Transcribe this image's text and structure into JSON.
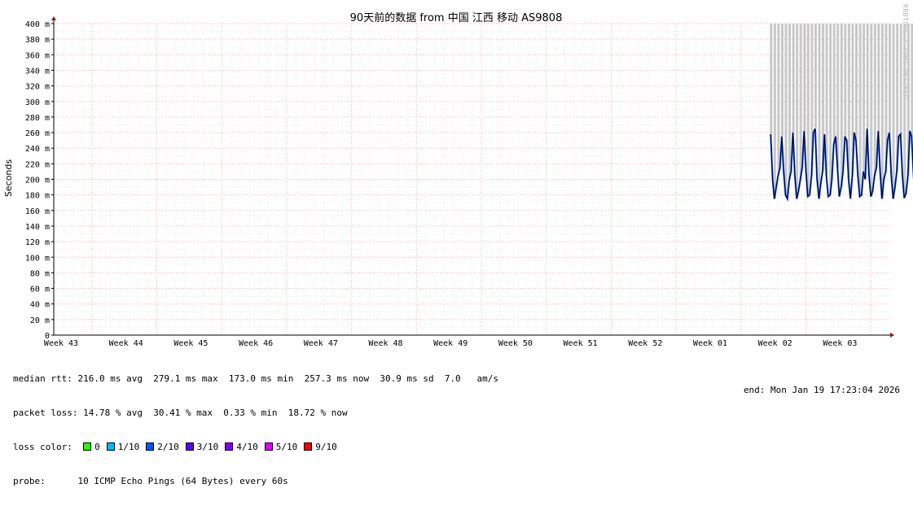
{
  "title": "90天前的数据 from 中国 江西 移动 AS9808",
  "watermark": "RRDTOOL / TOBI OETIKER",
  "chart_data": {
    "type": "line",
    "ylabel": "Seconds",
    "ylim": [
      0,
      400
    ],
    "y_unit": "m",
    "y_ticks": [
      "0",
      "20 m",
      "40 m",
      "60 m",
      "80 m",
      "100 m",
      "120 m",
      "140 m",
      "160 m",
      "180 m",
      "200 m",
      "220 m",
      "240 m",
      "260 m",
      "280 m",
      "300 m",
      "320 m",
      "340 m",
      "360 m",
      "380 m",
      "400 m"
    ],
    "x_ticks": [
      "Week 43",
      "Week 44",
      "Week 45",
      "Week 46",
      "Week 47",
      "Week 48",
      "Week 49",
      "Week 50",
      "Week 51",
      "Week 52",
      "Week 01",
      "Week 02",
      "Week 03"
    ],
    "grid": true,
    "series": [
      {
        "color": "#000000",
        "x_days_from_week02_start": [
          -0.3,
          -0.1,
          0.1,
          0.3,
          0.5,
          0.7,
          0.9,
          1.1,
          1.3,
          1.5,
          1.7,
          1.9,
          2.1,
          2.3,
          2.5,
          2.7,
          2.9,
          3.1,
          3.3,
          3.5,
          3.7,
          3.9,
          4.1,
          4.3,
          4.5,
          4.7,
          4.9,
          5.1,
          5.3,
          5.5,
          5.7,
          5.9,
          6.1,
          6.3,
          6.5,
          6.7,
          6.9,
          7.1,
          7.3,
          7.5,
          7.7,
          7.9,
          8.1,
          8.3,
          8.5,
          8.7,
          8.9,
          9.1,
          9.3,
          9.5,
          9.7,
          9.9,
          10.1,
          10.3,
          10.5,
          10.7,
          10.9,
          11.1,
          11.3,
          11.5,
          11.7,
          11.9,
          12.1,
          12.3,
          12.5,
          12.7,
          12.9,
          13.1,
          13.3,
          13.5,
          13.7,
          13.9,
          14.1,
          14.3,
          14.5,
          14.7,
          14.9,
          15.1,
          15.3,
          15.5,
          15.7,
          15.9,
          16.1,
          16.3,
          16.5,
          16.7,
          16.9,
          17.1,
          17.3,
          17.5,
          17.7,
          17.9,
          18.1,
          18.3,
          18.5,
          18.7,
          18.9,
          19.1,
          19.3
        ],
        "y_ms": [
          258,
          200,
          175,
          190,
          205,
          215,
          255,
          210,
          180,
          175,
          200,
          210,
          260,
          205,
          175,
          185,
          200,
          215,
          262,
          210,
          178,
          180,
          205,
          260,
          265,
          200,
          175,
          195,
          210,
          258,
          205,
          178,
          180,
          200,
          245,
          255,
          215,
          178,
          190,
          210,
          255,
          250,
          200,
          175,
          205,
          260,
          250,
          205,
          178,
          180,
          210,
          200,
          265,
          205,
          178,
          185,
          205,
          215,
          262,
          210,
          175,
          200,
          210,
          250,
          260,
          205,
          175,
          190,
          210,
          255,
          258,
          205,
          176,
          182,
          205,
          262,
          255,
          205,
          178,
          180,
          200,
          205,
          268,
          220,
          200,
          190,
          205,
          250,
          255,
          235,
          195,
          230,
          265,
          275,
          250,
          210,
          225,
          245,
          255
        ]
      }
    ],
    "loss_spikes_max": 400
  },
  "stats": {
    "median_rtt_label": "median rtt:",
    "median_rtt": " 216.0 ms avg  279.1 ms max  173.0 ms min  257.3 ms now  30.9 ms sd  7.0   am/s",
    "packet_loss_label": "packet loss:",
    "packet_loss": "14.78 % avg  30.41 % max  0.33 % min  18.72 % now",
    "loss_color_label": "loss color:",
    "loss_colors": [
      {
        "label": "0",
        "color": "#26ff00"
      },
      {
        "label": "1/10",
        "color": "#00b8ff"
      },
      {
        "label": "2/10",
        "color": "#0059ff"
      },
      {
        "label": "3/10",
        "color": "#5e00ff"
      },
      {
        "label": "4/10",
        "color": "#7e00ff"
      },
      {
        "label": "5/10",
        "color": "#dd00ff"
      },
      {
        "label": "9/10",
        "color": "#ff0000"
      }
    ],
    "probe_label": "probe:",
    "probe": "      10 ICMP Echo Pings (64 Bytes) every 60s",
    "end": "end: Mon Jan 19 17:23:04 2026"
  }
}
